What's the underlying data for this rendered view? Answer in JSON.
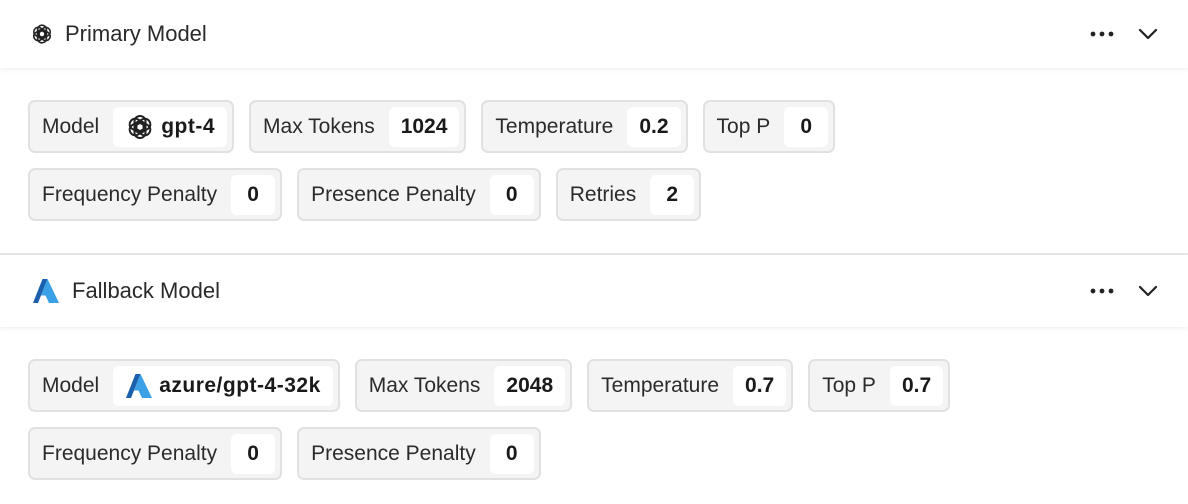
{
  "primary": {
    "title": "Primary Model",
    "logo_icon": "openai-icon",
    "params_row1": [
      {
        "label": "Model",
        "value": "gpt-4",
        "icon": "openai-icon"
      },
      {
        "label": "Max Tokens",
        "value": "1024"
      },
      {
        "label": "Temperature",
        "value": "0.2"
      },
      {
        "label": "Top P",
        "value": "0"
      }
    ],
    "params_row2": [
      {
        "label": "Frequency Penalty",
        "value": "0"
      },
      {
        "label": "Presence Penalty",
        "value": "0"
      },
      {
        "label": "Retries",
        "value": "2"
      }
    ]
  },
  "fallback": {
    "title": "Fallback Model",
    "logo_icon": "azure-icon",
    "params_row1": [
      {
        "label": "Model",
        "value": "azure/gpt-4-32k",
        "icon": "azure-icon"
      },
      {
        "label": "Max Tokens",
        "value": "2048"
      },
      {
        "label": "Temperature",
        "value": "0.7"
      },
      {
        "label": "Top P",
        "value": "0.7"
      }
    ],
    "params_row2": [
      {
        "label": "Frequency Penalty",
        "value": "0"
      },
      {
        "label": "Presence Penalty",
        "value": "0"
      }
    ]
  },
  "colors": {
    "azure_dark": "#1b5fad",
    "azure_light": "#3ba0e6",
    "chip_bg": "#f4f4f4",
    "chip_border": "#e1e1e1"
  }
}
